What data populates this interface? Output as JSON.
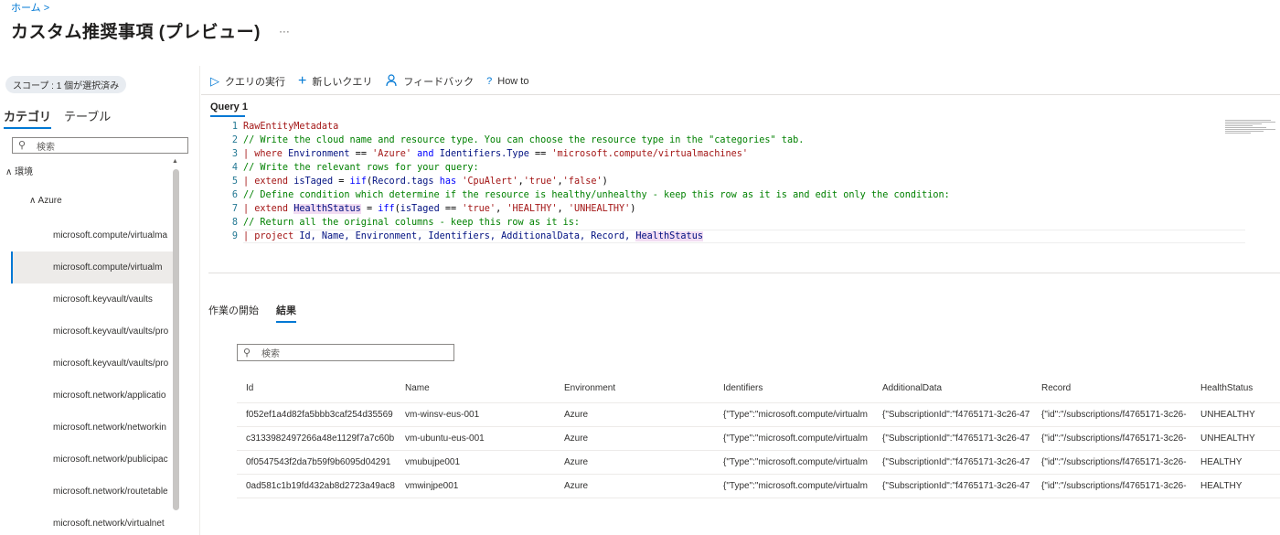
{
  "breadcrumb": "ホーム >",
  "page_title": "カスタム推奨事項 (プレビュー)",
  "more_label": "···",
  "scope_label": "スコープ : 1 個が選択済み",
  "category_tabs": [
    "カテゴリ",
    "テーブル"
  ],
  "left_search_placeholder": "検索",
  "tree": {
    "root": "∧ 環境",
    "azure": "∧ Azure",
    "items": [
      "microsoft.compute/virtualma",
      "microsoft.compute/virtualm",
      "microsoft.keyvault/vaults",
      "microsoft.keyvault/vaults/pro",
      "microsoft.keyvault/vaults/pro",
      "microsoft.network/applicatio",
      "microsoft.network/networkin",
      "microsoft.network/publicipac",
      "microsoft.network/routetable",
      "microsoft.network/virtualnet"
    ],
    "selected_index": 1
  },
  "toolbar": {
    "run_icon": "▷",
    "run_label": "クエリの実行",
    "new_icon": "+",
    "new_label": "新しいクエリ",
    "feedback_icon": "feedback-icon",
    "feedback_label": "フィードバック",
    "howto_icon": "?",
    "howto_label": "How to"
  },
  "query_tab": "Query 1",
  "code": [
    {
      "n": "1",
      "parts": [
        [
          "c-ent",
          "RawEntityMetadata"
        ]
      ]
    },
    {
      "n": "2",
      "parts": [
        [
          "c-comment",
          "// Write the cloud name and resource type. You can choose the resource type in the \"categories\" tab."
        ]
      ]
    },
    {
      "n": "3",
      "parts": [
        [
          "c-ent",
          "| where "
        ],
        [
          "c-plain",
          "Environment"
        ],
        [
          "c-dark",
          " == "
        ],
        [
          "c-str",
          "'Azure'"
        ],
        [
          "c-kw",
          " and "
        ],
        [
          "c-plain",
          "Identifiers.Type"
        ],
        [
          "c-dark",
          " == "
        ],
        [
          "c-str",
          "'microsoft.compute/virtualmachines'"
        ]
      ]
    },
    {
      "n": "4",
      "parts": [
        [
          "c-comment",
          "// Write the relevant rows for your query:"
        ]
      ]
    },
    {
      "n": "5",
      "parts": [
        [
          "c-ent",
          "| extend "
        ],
        [
          "c-plain",
          "isTaged"
        ],
        [
          "c-dark",
          " = "
        ],
        [
          "c-kw",
          "iif"
        ],
        [
          "c-dark",
          "("
        ],
        [
          "c-plain",
          "Record.tags"
        ],
        [
          "c-kw",
          " has "
        ],
        [
          "c-str",
          "'CpuAlert'"
        ],
        [
          "c-dark",
          ","
        ],
        [
          "c-str",
          "'true'"
        ],
        [
          "c-dark",
          ","
        ],
        [
          "c-str",
          "'false'"
        ],
        [
          "c-dark",
          ")"
        ]
      ]
    },
    {
      "n": "6",
      "parts": [
        [
          "c-comment",
          "// Define condition which determine if the resource is healthy/unhealthy - keep this row as it is and edit only the condition:"
        ]
      ]
    },
    {
      "n": "7",
      "parts": [
        [
          "c-ent",
          "| extend "
        ],
        [
          "c-plain hl",
          "HealthStatus"
        ],
        [
          "c-dark",
          " = "
        ],
        [
          "c-kw",
          "iff"
        ],
        [
          "c-dark",
          "("
        ],
        [
          "c-plain",
          "isTaged"
        ],
        [
          "c-dark",
          " == "
        ],
        [
          "c-str",
          "'true'"
        ],
        [
          "c-dark",
          ", "
        ],
        [
          "c-str",
          "'HEALTHY'"
        ],
        [
          "c-dark",
          ", "
        ],
        [
          "c-str",
          "'UNHEALTHY'"
        ],
        [
          "c-dark",
          ")"
        ]
      ]
    },
    {
      "n": "8",
      "parts": [
        [
          "c-comment",
          "// Return all the original columns - keep this row as it is:"
        ]
      ]
    },
    {
      "n": "9",
      "parts": [
        [
          "c-ent",
          "| project "
        ],
        [
          "c-plain",
          "Id, Name, Environment, Identifiers, AdditionalData, Record, "
        ],
        [
          "c-plain hl",
          "HealthStatus"
        ]
      ]
    }
  ],
  "result_tabs": [
    "作業の開始",
    "結果"
  ],
  "result_search_placeholder": "検索",
  "table": {
    "columns": [
      "Id",
      "Name",
      "Environment",
      "Identifiers",
      "AdditionalData",
      "Record",
      "HealthStatus"
    ],
    "rows": [
      [
        "f052ef1a4d82fa5bbb3caf254d35569",
        "vm-winsv-eus-001",
        "Azure",
        "{\"Type\":\"microsoft.compute/virtualm",
        "{\"SubscriptionId\":\"f4765171-3c26-47",
        "{\"id\":\"/subscriptions/f4765171-3c26-",
        "UNHEALTHY"
      ],
      [
        "c3133982497266a48e1129f7a7c60b",
        "vm-ubuntu-eus-001",
        "Azure",
        "{\"Type\":\"microsoft.compute/virtualm",
        "{\"SubscriptionId\":\"f4765171-3c26-47",
        "{\"id\":\"/subscriptions/f4765171-3c26-",
        "UNHEALTHY"
      ],
      [
        "0f0547543f2da7b59f9b6095d04291",
        "vmubujpe001",
        "Azure",
        "{\"Type\":\"microsoft.compute/virtualm",
        "{\"SubscriptionId\":\"f4765171-3c26-47",
        "{\"id\":\"/subscriptions/f4765171-3c26-",
        "HEALTHY"
      ],
      [
        "0ad581c1b19fd432ab8d2723a49ac8",
        "vmwinjpe001",
        "Azure",
        "{\"Type\":\"microsoft.compute/virtualm",
        "{\"SubscriptionId\":\"f4765171-3c26-47",
        "{\"id\":\"/subscriptions/f4765171-3c26-",
        "HEALTHY"
      ]
    ]
  },
  "colors": {
    "accent": "#0078d4",
    "comment": "#008000",
    "string": "#a31515",
    "keyword": "#0000ff"
  }
}
